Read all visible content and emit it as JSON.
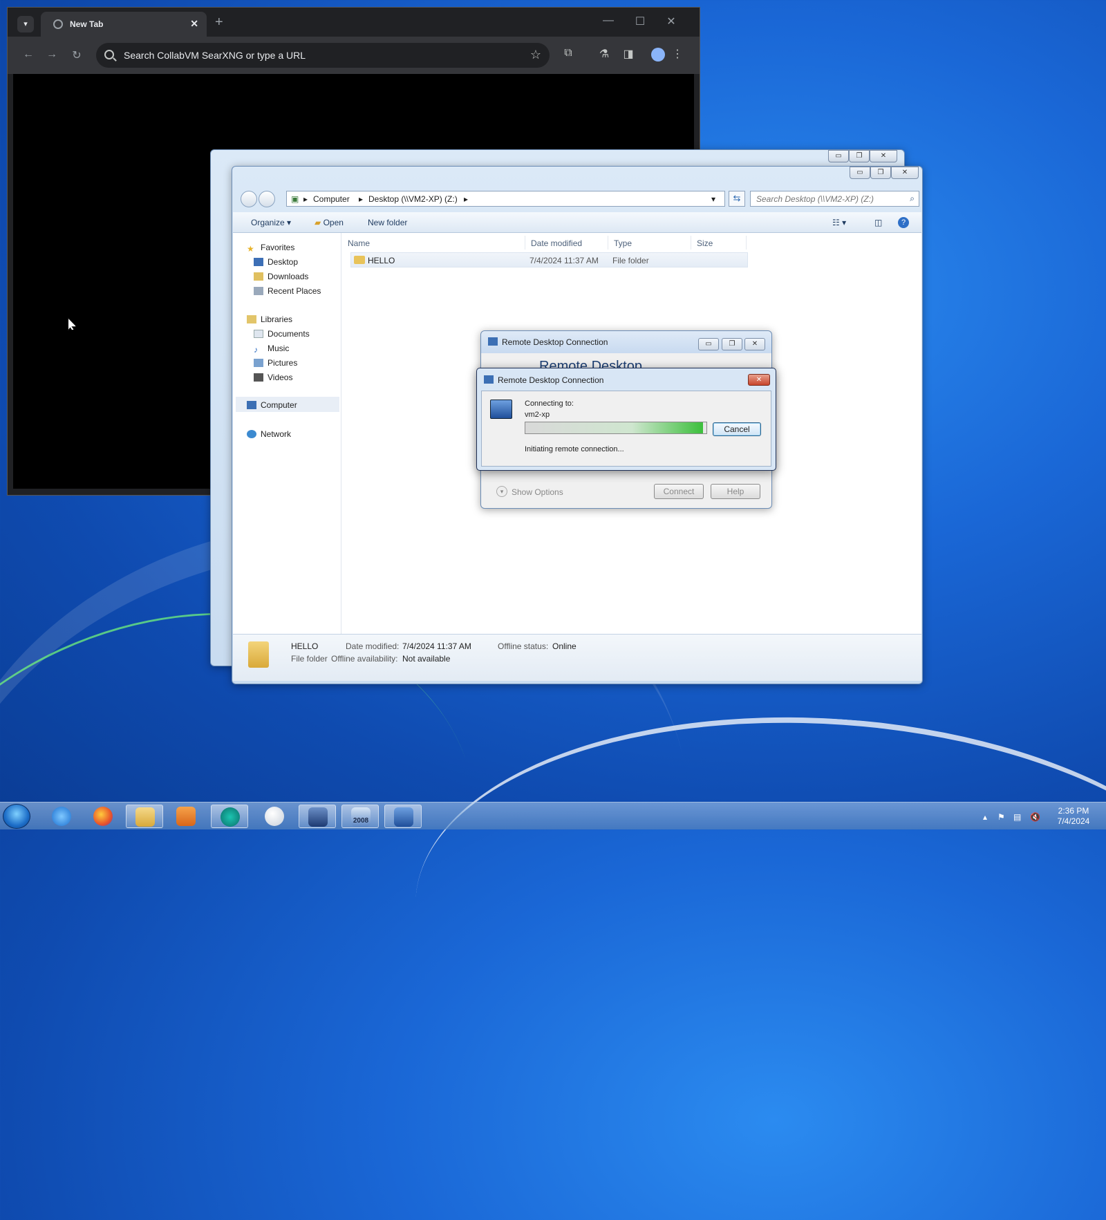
{
  "chrome": {
    "tab_title": "New Tab",
    "new_tab_label": "+",
    "omnibox_placeholder": "Search CollabVM SearXNG or type a URL"
  },
  "explorer": {
    "breadcrumb": [
      "Computer",
      "Desktop (\\\\VM2-XP) (Z:)"
    ],
    "search_placeholder": "Search Desktop (\\\\VM2-XP) (Z:)",
    "commands": {
      "organize": "Organize",
      "open": "Open",
      "new_folder": "New folder"
    },
    "nav": {
      "favorites": "Favorites",
      "desktop": "Desktop",
      "downloads": "Downloads",
      "recent": "Recent Places",
      "libraries": "Libraries",
      "documents": "Documents",
      "music": "Music",
      "pictures": "Pictures",
      "videos": "Videos",
      "computer": "Computer",
      "network": "Network"
    },
    "columns": {
      "name": "Name",
      "date": "Date modified",
      "type": "Type",
      "size": "Size"
    },
    "rows": [
      {
        "name": "HELLO",
        "date": "7/4/2024 11:37 AM",
        "type": "File folder",
        "size": ""
      }
    ],
    "details": {
      "name": "HELLO",
      "kind": "File folder",
      "date_label": "Date modified:",
      "date_value": "7/4/2024 11:37 AM",
      "offline_avail_label": "Offline availability:",
      "offline_avail_value": "Not available",
      "offline_status_label": "Offline status:",
      "offline_status_value": "Online"
    }
  },
  "rdc": {
    "title": "Remote Desktop Connection",
    "banner": "Remote Desktop",
    "show_options": "Show Options",
    "connect": "Connect",
    "help": "Help"
  },
  "connecting": {
    "title": "Remote Desktop Connection",
    "connecting_to": "Connecting to:",
    "host": "vm2-xp",
    "status": "Initiating remote connection...",
    "cancel": "Cancel",
    "progress": 0.98
  },
  "taskbar": {
    "vs_badge": "2008",
    "clock_time": "2:36 PM",
    "clock_date": "7/4/2024"
  }
}
